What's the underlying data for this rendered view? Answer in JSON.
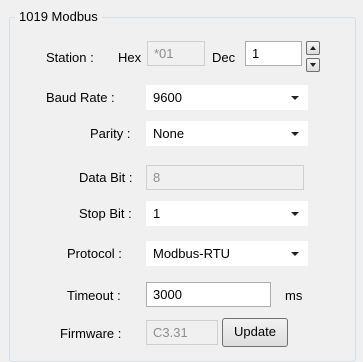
{
  "group_title": "1019 Modbus",
  "station": {
    "label": "Station :",
    "hex_label": "Hex",
    "hex_value": "*01",
    "dec_label": "Dec",
    "dec_value": "1"
  },
  "baud_rate": {
    "label": "Baud Rate :",
    "value": "9600"
  },
  "parity": {
    "label": "Parity :",
    "value": "None"
  },
  "data_bit": {
    "label": "Data Bit :",
    "value": "8"
  },
  "stop_bit": {
    "label": "Stop Bit :",
    "value": "1"
  },
  "protocol": {
    "label": "Protocol :",
    "value": "Modbus-RTU"
  },
  "timeout": {
    "label": "Timeout :",
    "value": "3000",
    "unit": "ms"
  },
  "firmware": {
    "label": "Firmware :",
    "value": "C3.31",
    "update_label": "Update"
  },
  "icons": {
    "spin_up": "chevron-up-icon",
    "spin_down": "chevron-down-icon",
    "dropdown": "caret-down-icon"
  }
}
